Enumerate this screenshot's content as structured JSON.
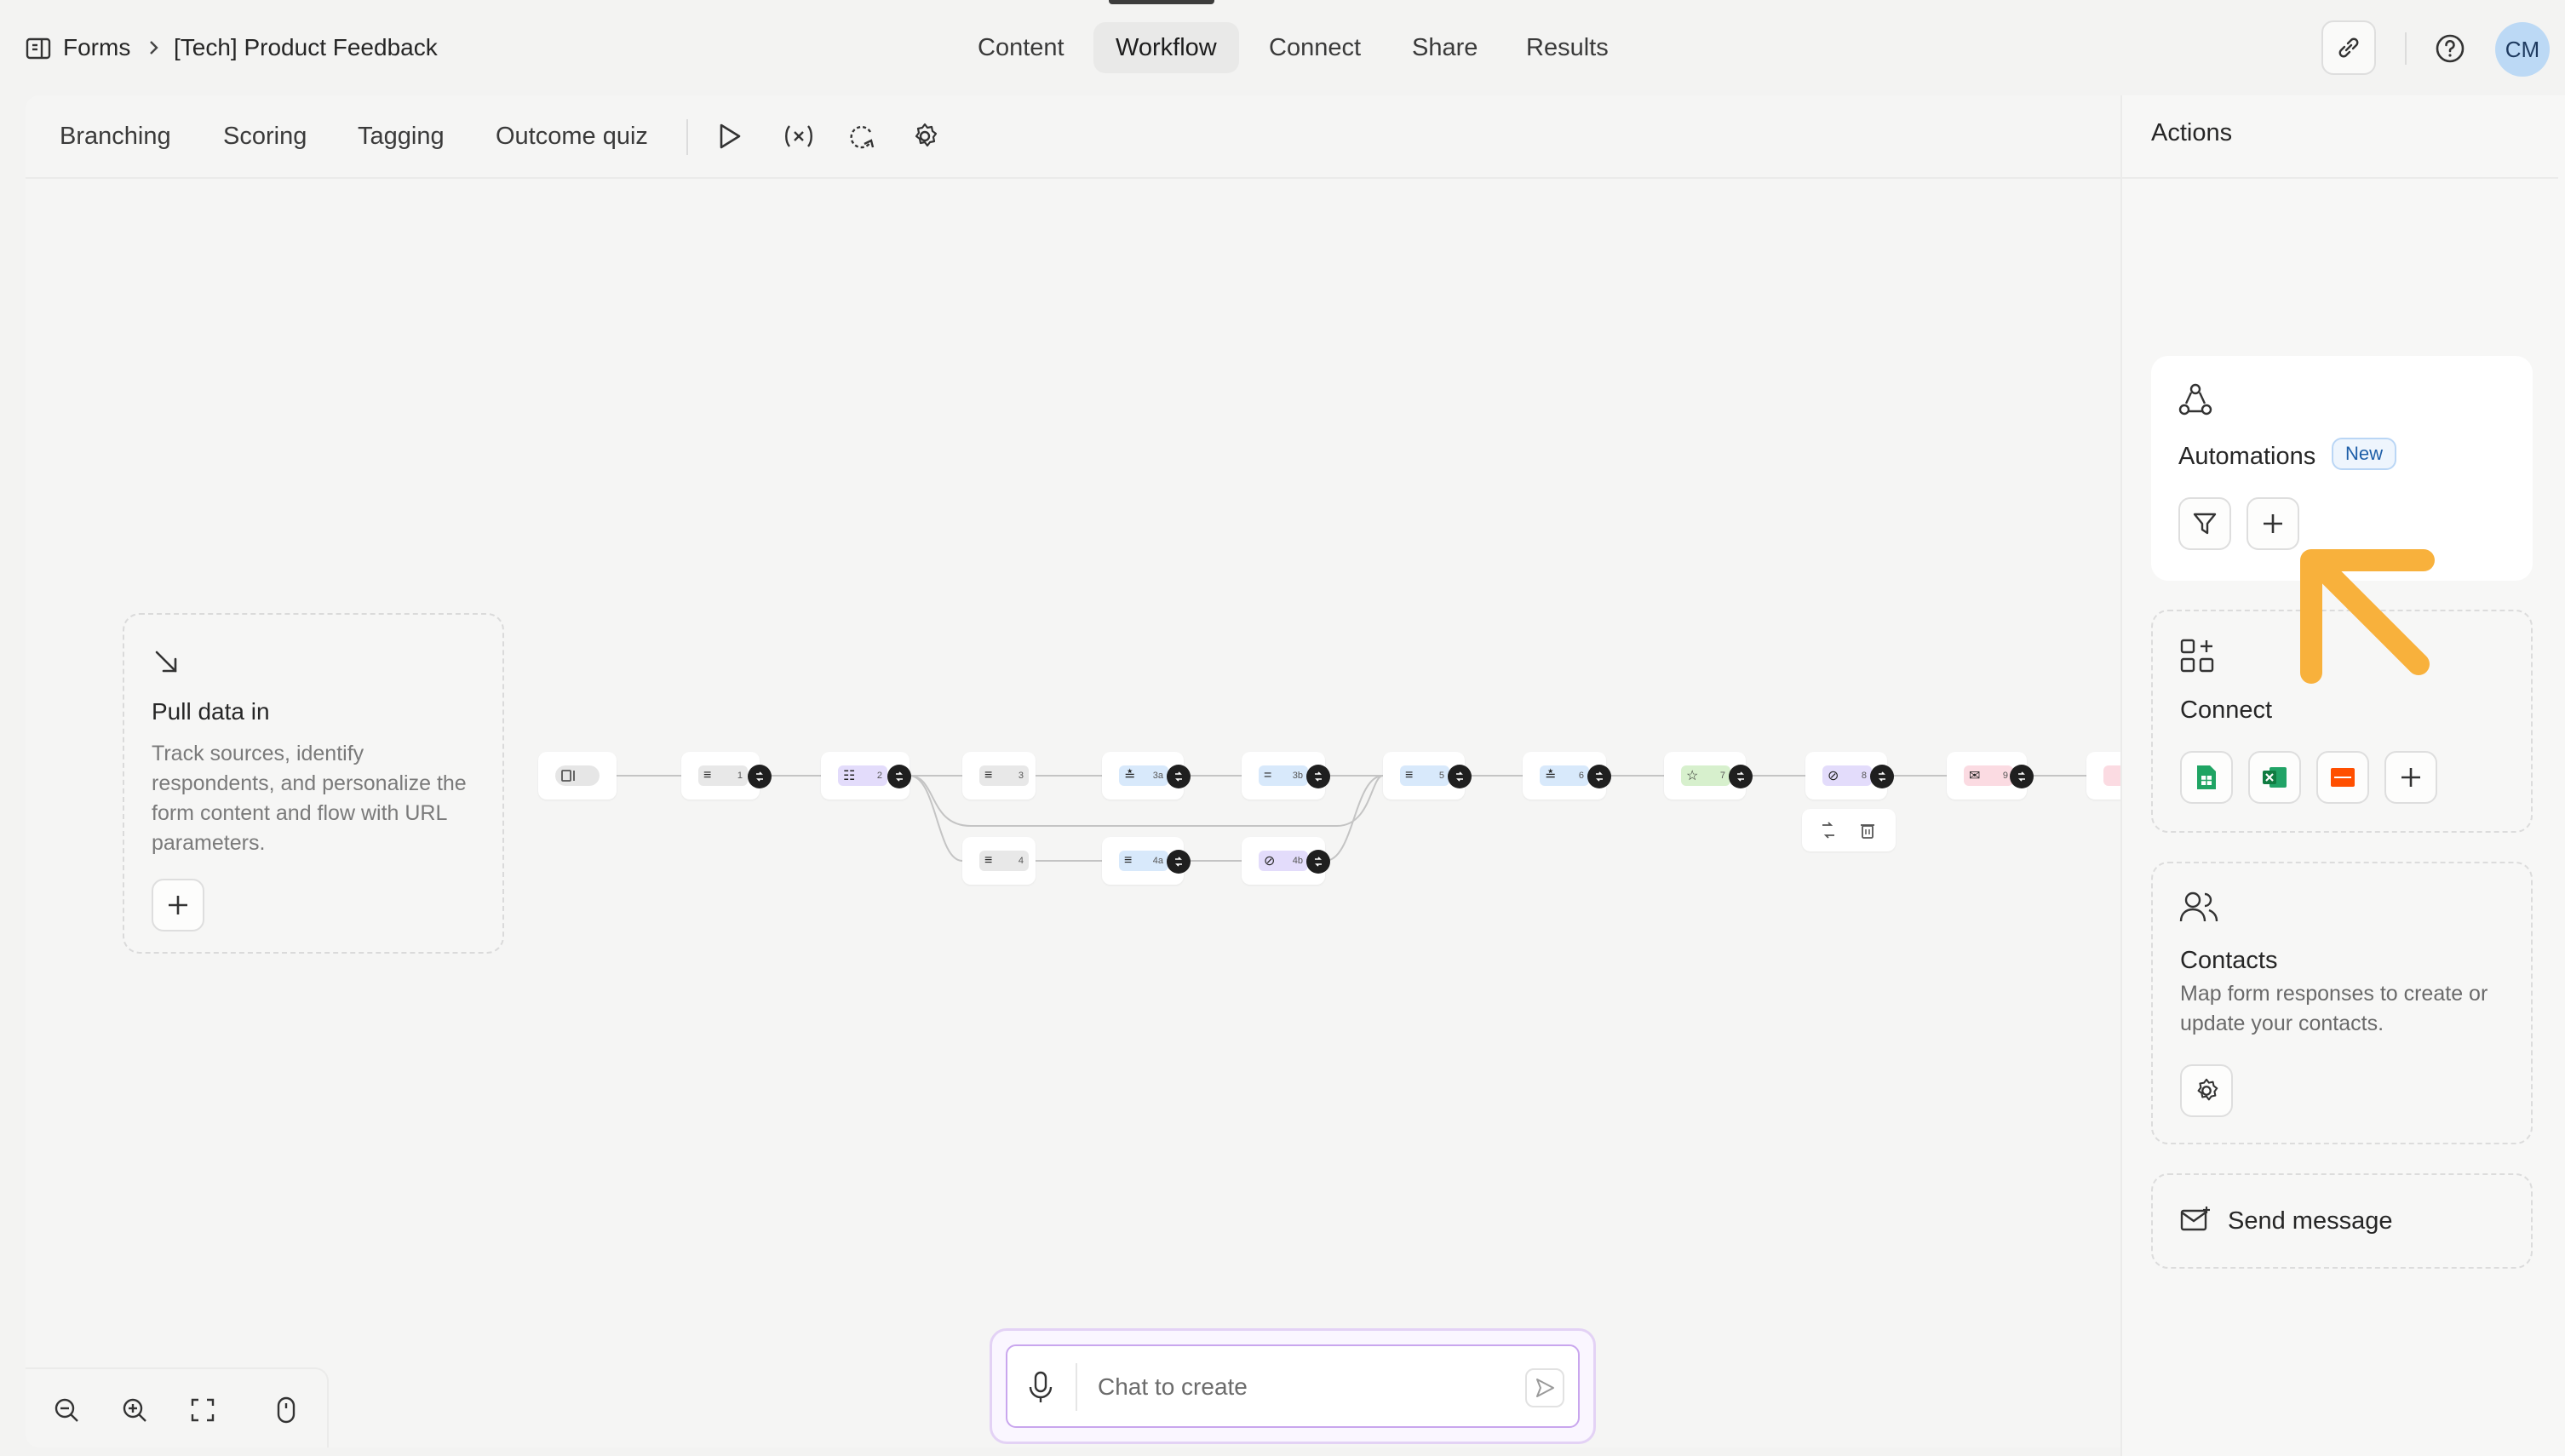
{
  "breadcrumb": {
    "root": "Forms",
    "current": "[Tech] Product Feedback"
  },
  "tabs": [
    {
      "label": "Content",
      "active": false
    },
    {
      "label": "Workflow",
      "active": true
    },
    {
      "label": "Connect",
      "active": false
    },
    {
      "label": "Share",
      "active": false
    },
    {
      "label": "Results",
      "active": false
    }
  ],
  "user": {
    "initials": "CM"
  },
  "toolbar": {
    "items": [
      "Branching",
      "Scoring",
      "Tagging",
      "Outcome quiz"
    ],
    "icons": [
      "play-icon",
      "variables-icon",
      "loop-icon",
      "gear-icon"
    ]
  },
  "pull_data": {
    "title": "Pull data in",
    "description": "Track sources, identify respondents, and personalize the form content and flow with URL parameters."
  },
  "flow_nodes": [
    {
      "label": "1"
    },
    {
      "label": "2"
    },
    {
      "label": "3"
    },
    {
      "label": "3a"
    },
    {
      "label": "3b"
    },
    {
      "label": "5"
    },
    {
      "label": "6"
    },
    {
      "label": "7"
    },
    {
      "label": "8"
    },
    {
      "label": "9"
    },
    {
      "label": "4"
    },
    {
      "label": "4a"
    },
    {
      "label": "4b"
    }
  ],
  "chat": {
    "placeholder": "Chat to create"
  },
  "actions": {
    "title": "Actions",
    "automations": {
      "title": "Automations",
      "badge": "New"
    },
    "connect": {
      "title": "Connect"
    },
    "contacts": {
      "title": "Contacts",
      "description": "Map form responses to create or update your contacts."
    },
    "send_message": {
      "title": "Send message"
    }
  },
  "colors": {
    "accent_arrow": "#f8b13c",
    "chat_border": "#c9a6ee",
    "badge_blue": "#1f5fa8",
    "avatar_bg": "#bcd9f5"
  }
}
